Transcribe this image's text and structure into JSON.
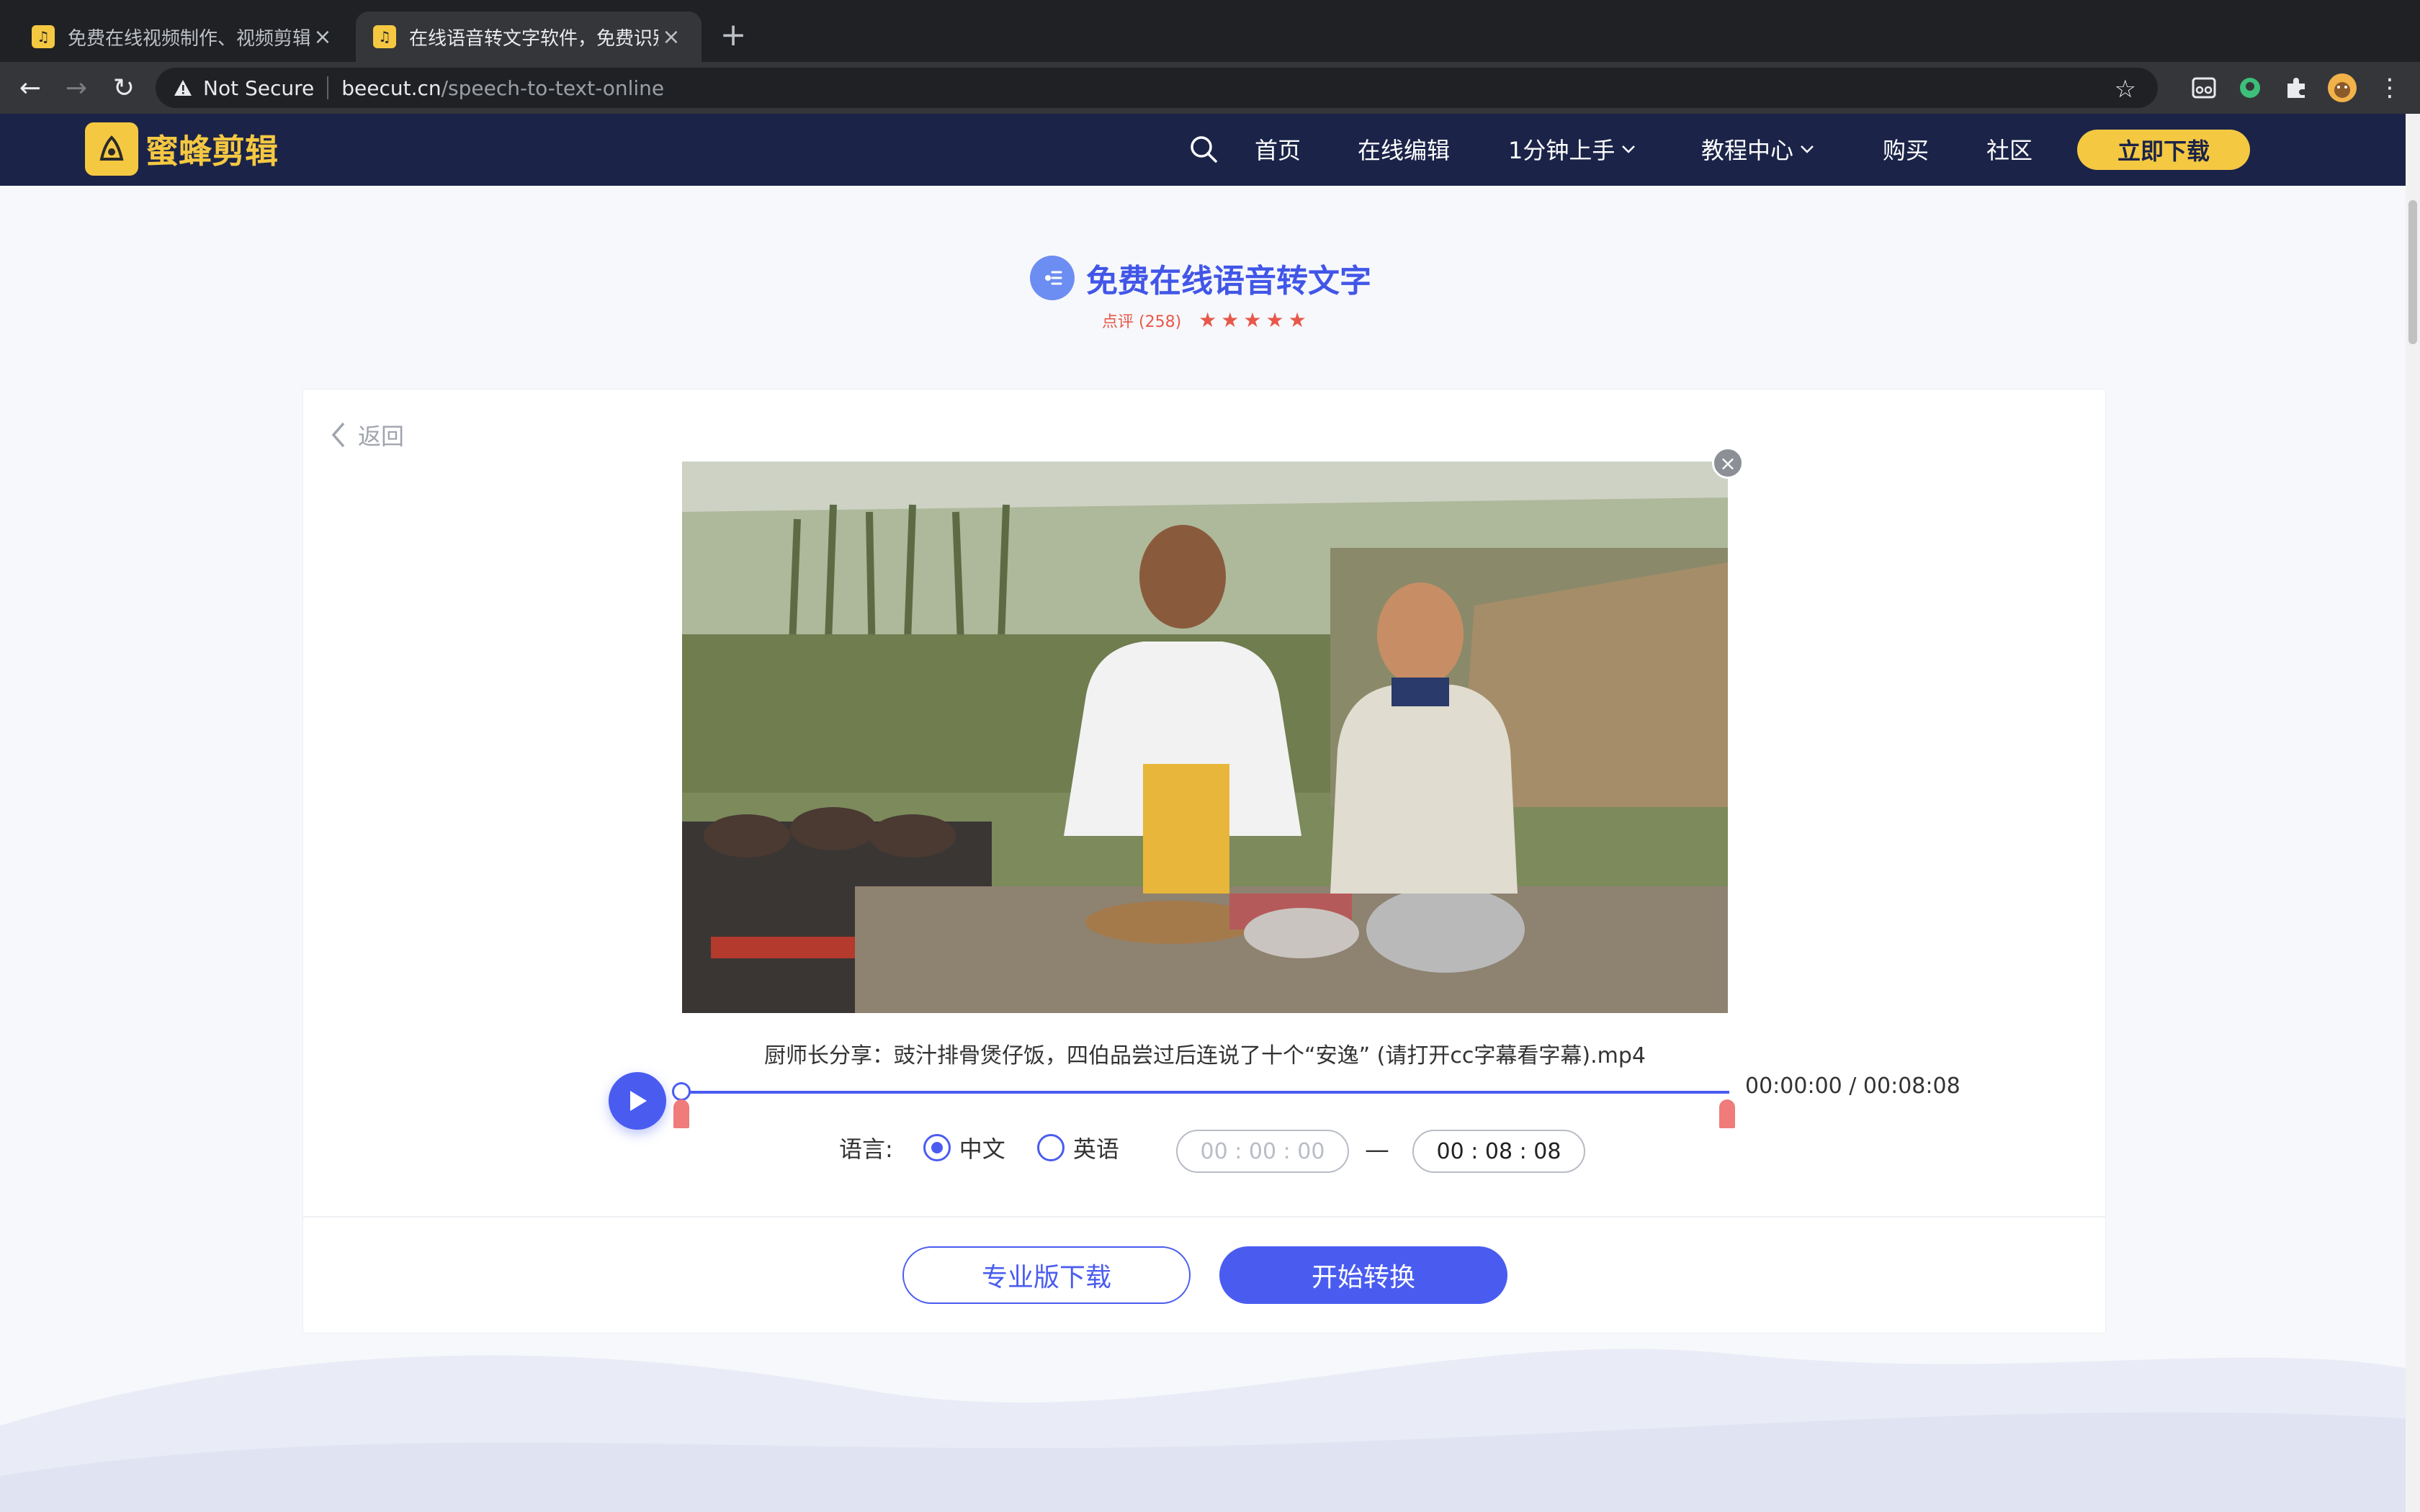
{
  "browser": {
    "tabs": [
      {
        "title": "免费在线视频制作、视频剪辑、视",
        "active": false
      },
      {
        "title": "在线语音转文字软件，免费识别语",
        "active": true
      }
    ],
    "new_tab_label": "+",
    "security_label": "Not Secure",
    "url_host": "beecut.cn",
    "url_path": "/speech-to-text-online"
  },
  "site": {
    "logo_text": "蜜蜂剪辑",
    "nav": [
      {
        "label": "首页"
      },
      {
        "label": "在线编辑"
      },
      {
        "label": "1分钟上手",
        "dropdown": true
      },
      {
        "label": "教程中心",
        "dropdown": true
      },
      {
        "label": "购买"
      },
      {
        "label": "社区"
      }
    ],
    "download_label": "立即下载"
  },
  "page": {
    "title": "免费在线语音转文字",
    "rating_text": "点评 (258)",
    "stars": 5
  },
  "editor": {
    "back_label": "返回",
    "filename": "厨师长分享：豉汁排骨煲仔饭，四伯品尝过后连说了十个“安逸” (请打开cc字幕看字幕).mp4",
    "time_display": "00:00:00 / 00:08:08",
    "language_label": "语言:",
    "languages": [
      {
        "label": "中文",
        "selected": true
      },
      {
        "label": "英语",
        "selected": false
      }
    ],
    "start_time": "00 : 00 : 00",
    "range_separator": "—",
    "end_time": "00 : 08 : 08"
  },
  "actions": {
    "pro_download": "专业版下载",
    "start_convert": "开始转换"
  },
  "colors": {
    "brand_yellow": "#f5c842",
    "header_navy": "#1b2448",
    "accent_blue": "#4a5cf0",
    "rating_red": "#e8584a"
  }
}
